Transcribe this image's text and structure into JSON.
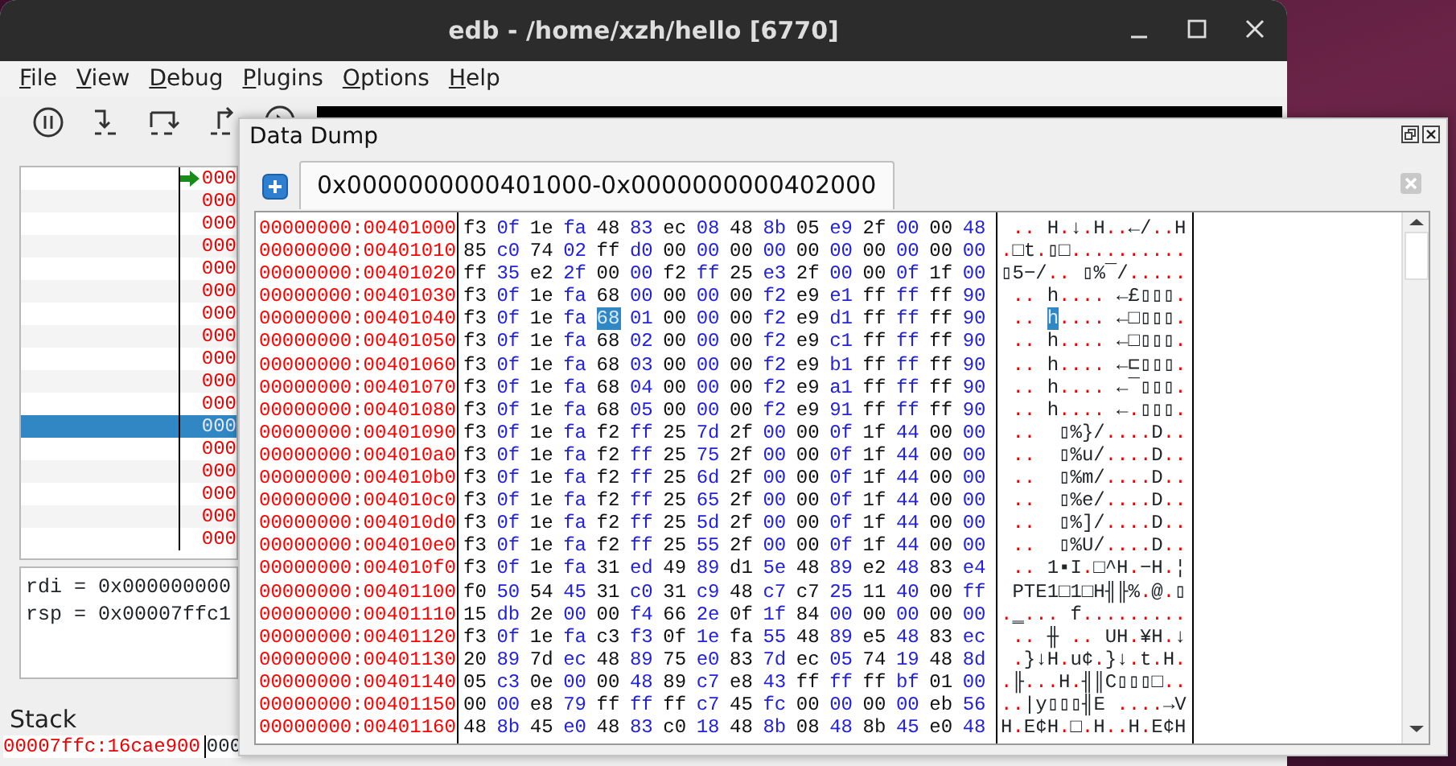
{
  "window": {
    "title": "edb - /home/xzh/hello [6770]"
  },
  "menu": [
    "File",
    "View",
    "Debug",
    "Plugins",
    "Options",
    "Help"
  ],
  "disassembly": {
    "rows": [
      {
        "address": "000",
        "current": true,
        "selected": false
      },
      {
        "address": "000",
        "current": false,
        "selected": false
      },
      {
        "address": "000",
        "current": false,
        "selected": false
      },
      {
        "address": "000",
        "current": false,
        "selected": false
      },
      {
        "address": "000",
        "current": false,
        "selected": false
      },
      {
        "address": "000",
        "current": false,
        "selected": false
      },
      {
        "address": "000",
        "current": false,
        "selected": false
      },
      {
        "address": "000",
        "current": false,
        "selected": false
      },
      {
        "address": "000",
        "current": false,
        "selected": false
      },
      {
        "address": "000",
        "current": false,
        "selected": false
      },
      {
        "address": "000",
        "current": false,
        "selected": false
      },
      {
        "address": "000",
        "current": false,
        "selected": true
      },
      {
        "address": "000",
        "current": false,
        "selected": false
      },
      {
        "address": "000",
        "current": false,
        "selected": false
      },
      {
        "address": "000",
        "current": false,
        "selected": false
      },
      {
        "address": "000",
        "current": false,
        "selected": false
      },
      {
        "address": "000",
        "current": false,
        "selected": false
      }
    ]
  },
  "registers": [
    "rdi = 0x000000000",
    "rsp = 0x00007ffc1"
  ],
  "stack": {
    "title": "Stack",
    "rows": [
      {
        "address": "00007ffc:16cae900",
        "value": "000"
      }
    ]
  },
  "data_dump": {
    "title": "Data Dump",
    "tabs": [
      {
        "label": "0x0000000000401000-0x0000000000402000",
        "selected": true
      }
    ],
    "rows": [
      {
        "address": "00000000:00401000",
        "hex": [
          {
            "text": "f3 0f 1e fa 48 83 ec 08 48 8b 05 e9 2f 00 00 48",
            "selected": false
          }
        ],
        "ascii": [
          {
            "text": " .. H.↓.H..←/..H",
            "selected": false
          }
        ]
      },
      {
        "address": "00000000:00401010",
        "hex": [
          {
            "text": "85 c0 74 02 ff d0 00 00 00 00 00 00 00 00 00 00",
            "selected": false
          }
        ],
        "ascii": [
          {
            "text": ".□t.▯□..........",
            "selected": false
          }
        ]
      },
      {
        "address": "00000000:00401020",
        "hex": [
          {
            "text": "ff 35 e2 2f 00 00 f2 ff 25 e3 2f 00 00 0f 1f 00",
            "selected": false
          }
        ],
        "ascii": [
          {
            "text": "▯5−/.. ▯%¯/.....",
            "selected": false
          }
        ]
      },
      {
        "address": "00000000:00401030",
        "hex": [
          {
            "text": "f3 0f 1e fa 68 00 00 00 00 f2 e9 e1 ff ff ff 90",
            "selected": false
          }
        ],
        "ascii": [
          {
            "text": " .. h.... ←£▯▯▯.",
            "selected": false
          }
        ]
      },
      {
        "address": "00000000:00401040",
        "hex": [
          {
            "text": "f3 0f 1e fa",
            "selected": false
          },
          {
            "text": "68",
            "selected": true
          },
          {
            "text": "01 00 00 00 f2 e9 d1 ff ff ff 90",
            "selected": false
          }
        ],
        "ascii": [
          {
            "text": " .. ",
            "selected": false
          },
          {
            "text": "h",
            "selected": true
          },
          {
            "text": ".... ←□▯▯▯.",
            "selected": false
          }
        ]
      },
      {
        "address": "00000000:00401050",
        "hex": [
          {
            "text": "f3 0f 1e fa 68 02 00 00 00 f2 e9 c1 ff ff ff 90",
            "selected": false
          }
        ],
        "ascii": [
          {
            "text": " .. h.... ←□▯▯▯.",
            "selected": false
          }
        ]
      },
      {
        "address": "00000000:00401060",
        "hex": [
          {
            "text": "f3 0f 1e fa 68 03 00 00 00 f2 e9 b1 ff ff ff 90",
            "selected": false
          }
        ],
        "ascii": [
          {
            "text": " .. h.... ←⊏▯▯▯.",
            "selected": false
          }
        ]
      },
      {
        "address": "00000000:00401070",
        "hex": [
          {
            "text": "f3 0f 1e fa 68 04 00 00 00 f2 e9 a1 ff ff ff 90",
            "selected": false
          }
        ],
        "ascii": [
          {
            "text": " .. h.... ←¯▯▯▯.",
            "selected": false
          }
        ]
      },
      {
        "address": "00000000:00401080",
        "hex": [
          {
            "text": "f3 0f 1e fa 68 05 00 00 00 f2 e9 91 ff ff ff 90",
            "selected": false
          }
        ],
        "ascii": [
          {
            "text": " .. h.... ←.▯▯▯.",
            "selected": false
          }
        ]
      },
      {
        "address": "00000000:00401090",
        "hex": [
          {
            "text": "f3 0f 1e fa f2 ff 25 7d 2f 00 00 0f 1f 44 00 00",
            "selected": false
          }
        ],
        "ascii": [
          {
            "text": " ..  ▯%}/....D..",
            "selected": false
          }
        ]
      },
      {
        "address": "00000000:004010a0",
        "hex": [
          {
            "text": "f3 0f 1e fa f2 ff 25 75 2f 00 00 0f 1f 44 00 00",
            "selected": false
          }
        ],
        "ascii": [
          {
            "text": " ..  ▯%u/....D..",
            "selected": false
          }
        ]
      },
      {
        "address": "00000000:004010b0",
        "hex": [
          {
            "text": "f3 0f 1e fa f2 ff 25 6d 2f 00 00 0f 1f 44 00 00",
            "selected": false
          }
        ],
        "ascii": [
          {
            "text": " ..  ▯%m/....D..",
            "selected": false
          }
        ]
      },
      {
        "address": "00000000:004010c0",
        "hex": [
          {
            "text": "f3 0f 1e fa f2 ff 25 65 2f 00 00 0f 1f 44 00 00",
            "selected": false
          }
        ],
        "ascii": [
          {
            "text": " ..  ▯%e/....D..",
            "selected": false
          }
        ]
      },
      {
        "address": "00000000:004010d0",
        "hex": [
          {
            "text": "f3 0f 1e fa f2 ff 25 5d 2f 00 00 0f 1f 44 00 00",
            "selected": false
          }
        ],
        "ascii": [
          {
            "text": " ..  ▯%]/....D..",
            "selected": false
          }
        ]
      },
      {
        "address": "00000000:004010e0",
        "hex": [
          {
            "text": "f3 0f 1e fa f2 ff 25 55 2f 00 00 0f 1f 44 00 00",
            "selected": false
          }
        ],
        "ascii": [
          {
            "text": " ..  ▯%U/....D..",
            "selected": false
          }
        ]
      },
      {
        "address": "00000000:004010f0",
        "hex": [
          {
            "text": "f3 0f 1e fa 31 ed 49 89 d1 5e 48 89 e2 48 83 e4",
            "selected": false
          }
        ],
        "ascii": [
          {
            "text": " .. 1▪I.□^H.−H.¦",
            "selected": false
          }
        ]
      },
      {
        "address": "00000000:00401100",
        "hex": [
          {
            "text": "f0 50 54 45 31 c0 31 c9 48 c7 c7 25 11 40 00 ff",
            "selected": false
          }
        ],
        "ascii": [
          {
            "text": " PTE1□1□H╢╟%.@.▯",
            "selected": false
          }
        ]
      },
      {
        "address": "00000000:00401110",
        "hex": [
          {
            "text": "15 db 2e 00 00 f4 66 2e 0f 1f 84 00 00 00 00 00",
            "selected": false
          }
        ],
        "ascii": [
          {
            "text": ".‗... f.........",
            "selected": false
          }
        ]
      },
      {
        "address": "00000000:00401120",
        "hex": [
          {
            "text": "f3 0f 1e fa c3 f3 0f 1e fa 55 48 89 e5 48 83 ec",
            "selected": false
          }
        ],
        "ascii": [
          {
            "text": " .. ╫ .. UH.¥H.↓",
            "selected": false
          }
        ]
      },
      {
        "address": "00000000:00401130",
        "hex": [
          {
            "text": "20 89 7d ec 48 89 75 e0 83 7d ec 05 74 19 48 8d",
            "selected": false
          }
        ],
        "ascii": [
          {
            "text": " .}↓H.u¢.}↓.t.H.",
            "selected": false
          }
        ]
      },
      {
        "address": "00000000:00401140",
        "hex": [
          {
            "text": "05 c3 0e 00 00 48 89 c7 e8 43 ff ff ff bf 01 00",
            "selected": false
          }
        ],
        "ascii": [
          {
            "text": ".╟...H.╢║C▯▯▯□..",
            "selected": false
          }
        ]
      },
      {
        "address": "00000000:00401150",
        "hex": [
          {
            "text": "00 00 e8 79 ff ff ff c7 45 fc 00 00 00 00 eb 56",
            "selected": false
          }
        ],
        "ascii": [
          {
            "text": "..|y▯▯▯╢E ....→V",
            "selected": false
          }
        ]
      },
      {
        "address": "00000000:00401160",
        "hex": [
          {
            "text": "48 8b 45 e0 48 83 c0 18 48 8b 08 48 8b 45 e0 48",
            "selected": false
          }
        ],
        "ascii": [
          {
            "text": "H.E¢H.□.H..H.E¢H",
            "selected": false
          }
        ]
      }
    ]
  }
}
